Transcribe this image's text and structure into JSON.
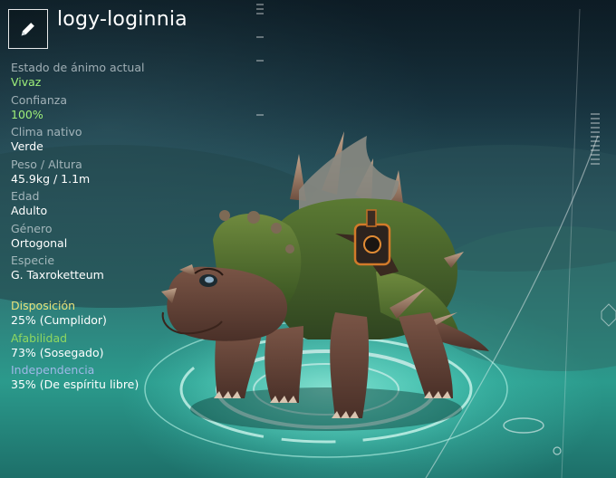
{
  "header": {
    "name": "logy-loginnia",
    "edit_icon": "pencil-icon"
  },
  "stats": [
    {
      "label": "Estado de ánimo actual",
      "value": "Vivaz",
      "highlight": true
    },
    {
      "label": "Confianza",
      "value": "100%",
      "highlight": true
    },
    {
      "label": "Clima nativo",
      "value": "Verde",
      "highlight": false
    },
    {
      "label": "Peso / Altura",
      "value": "45.9kg / 1.1m",
      "highlight": false
    },
    {
      "label": "Edad",
      "value": "Adulto",
      "highlight": false
    },
    {
      "label": "Género",
      "value": "Ortogonal",
      "highlight": false
    },
    {
      "label": "Especie",
      "value": "G. Taxroketteum",
      "highlight": false
    }
  ],
  "traits": [
    {
      "label": "Disposición",
      "value": "25% (Cumplidor)",
      "color": "#e8e07a"
    },
    {
      "label": "Afabilidad",
      "value": "73% (Sosegado)",
      "color": "#8fd860"
    },
    {
      "label": "Independencia",
      "value": "35% (De espíritu libre)",
      "color": "#9fb8e8"
    }
  ],
  "colors": {
    "highlight_green": "#9ff07a",
    "creature_skin": "#6b4a3e",
    "creature_shell": "#4f6a2c",
    "holo_ring": "#c9fff2"
  }
}
